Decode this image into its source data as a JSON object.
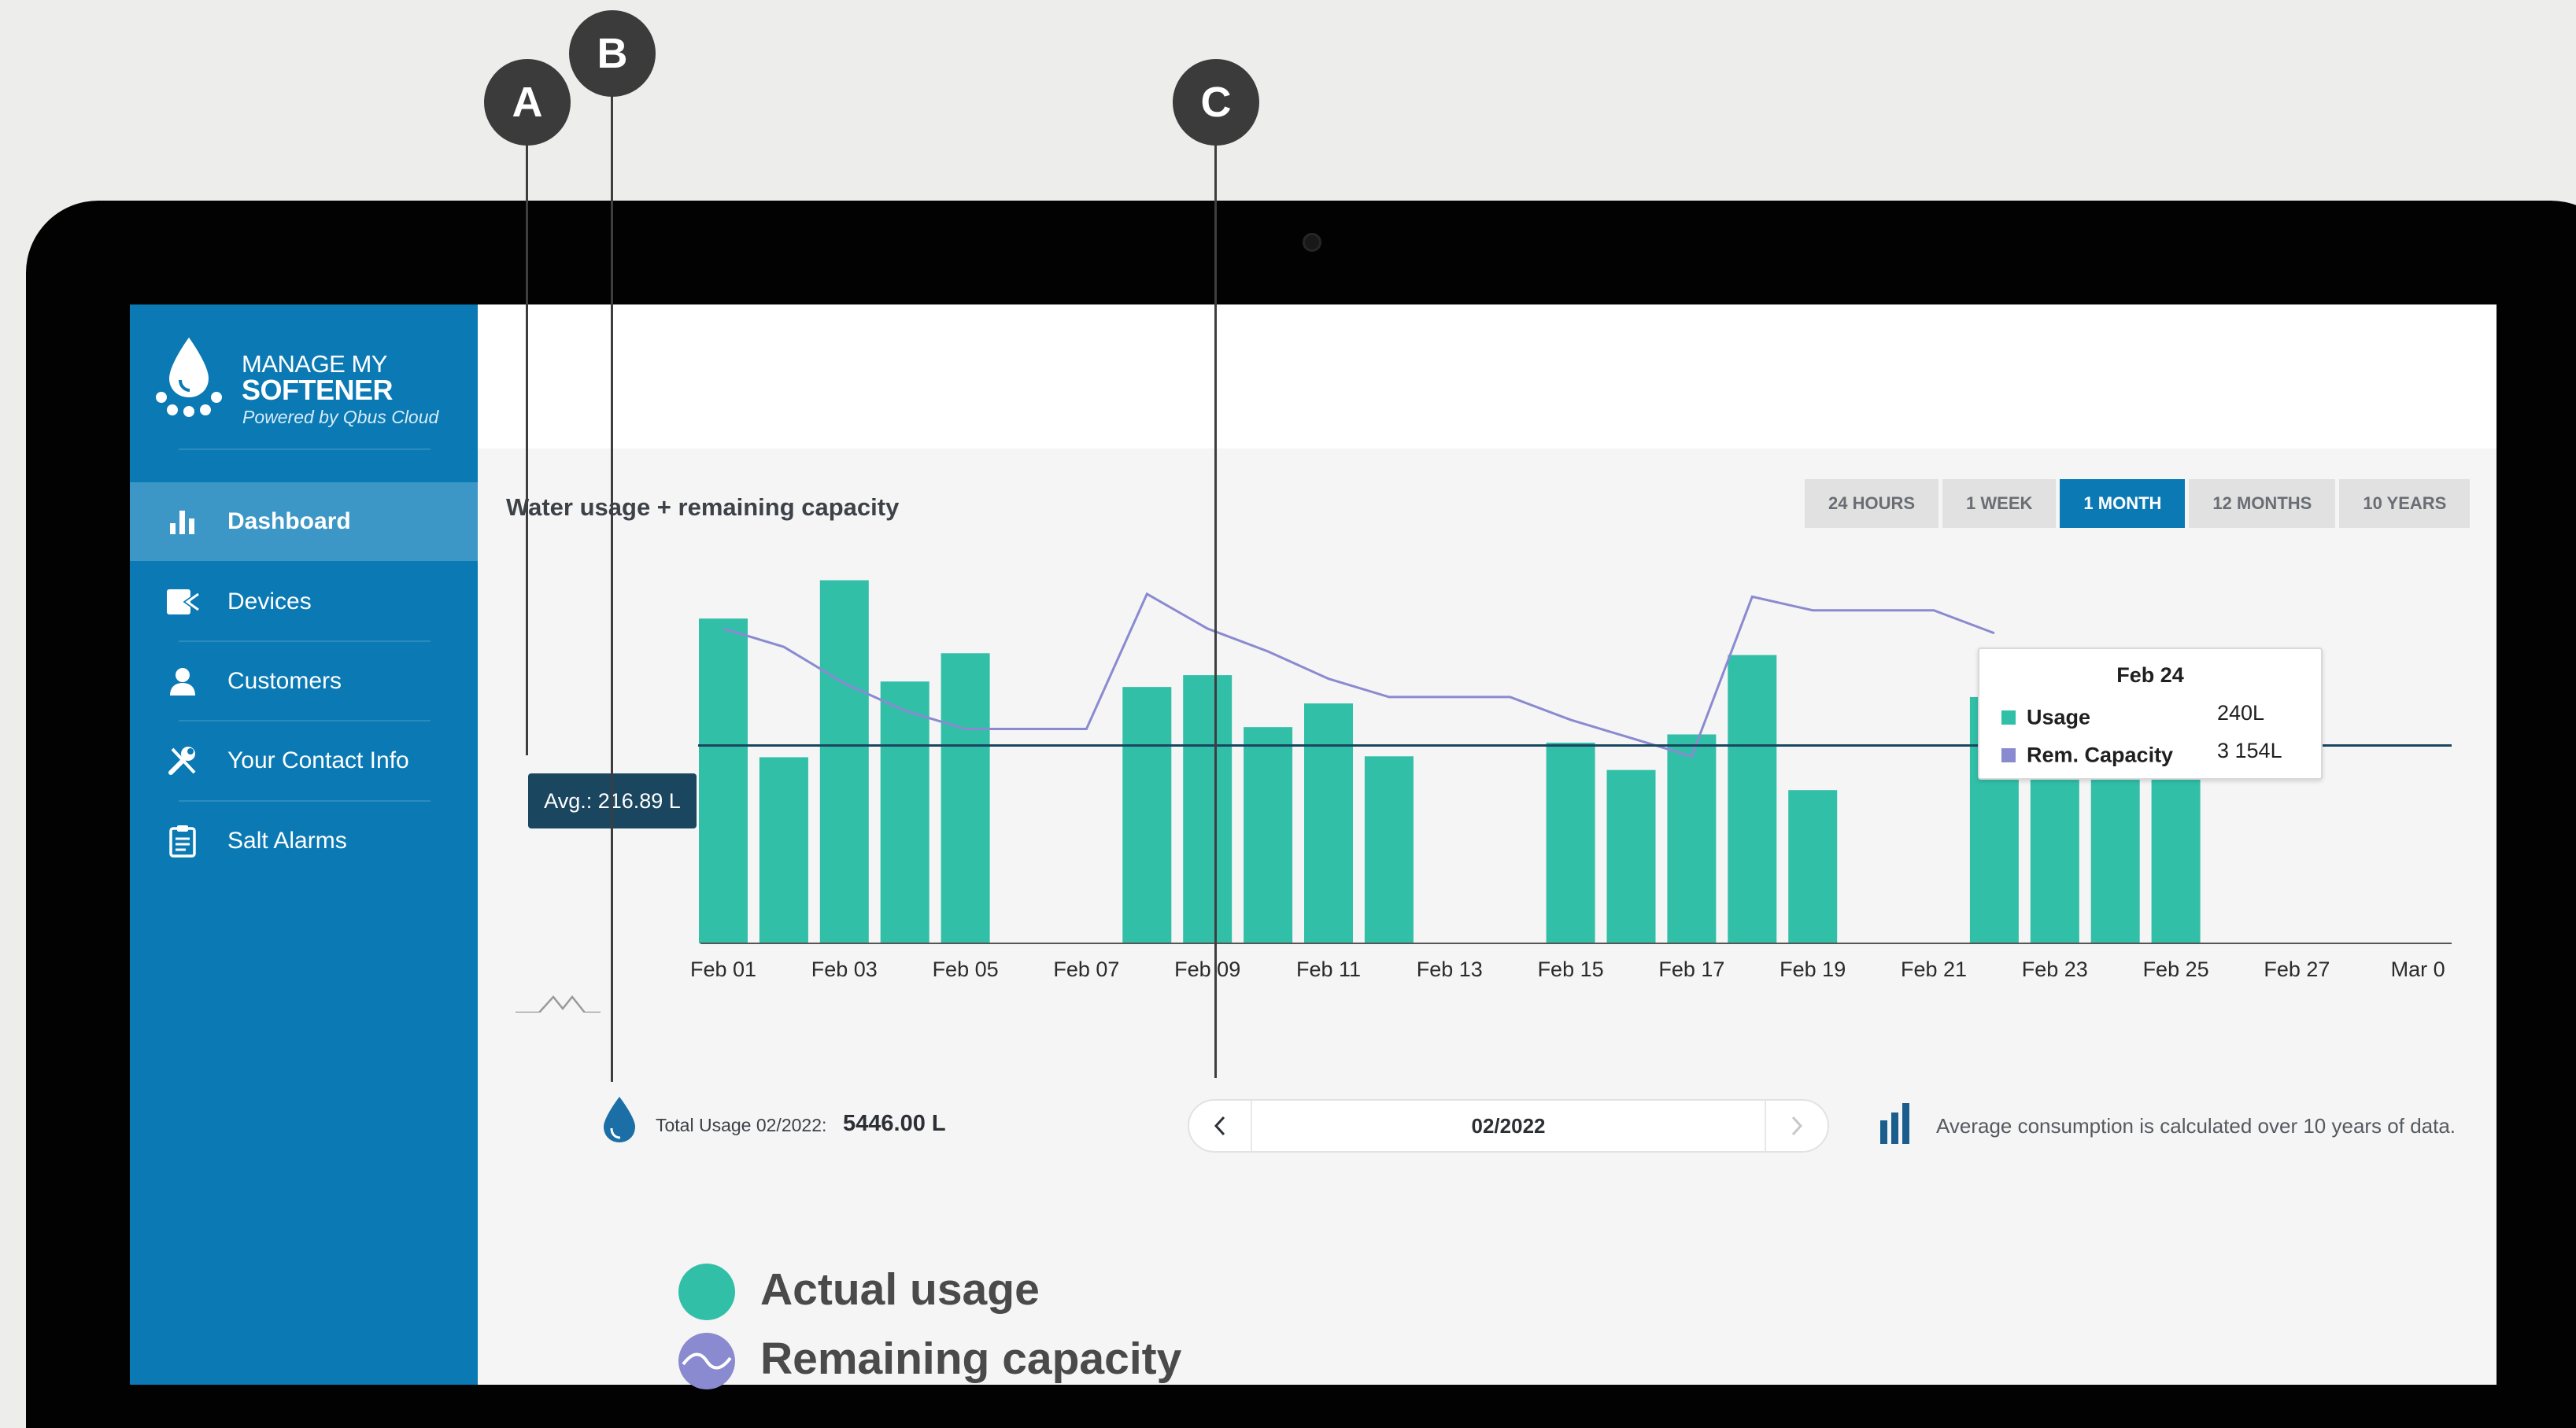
{
  "app": {
    "brand_line1": "MANAGE MY",
    "brand_line2": "SOFTENER",
    "brand_tagline": "Powered by Qbus Cloud"
  },
  "sidebar": {
    "items": [
      {
        "label": "Dashboard",
        "icon": "bar-chart-icon",
        "active": true
      },
      {
        "label": "Devices",
        "icon": "device-icon",
        "active": false
      },
      {
        "label": "Customers",
        "icon": "user-icon",
        "active": false
      },
      {
        "label": "Your Contact Info",
        "icon": "tools-icon",
        "active": false
      },
      {
        "label": "Salt Alarms",
        "icon": "clipboard-icon",
        "active": false
      }
    ]
  },
  "chart_panel": {
    "title": "Water usage + remaining capacity",
    "range_tabs": [
      "24 HOURS",
      "1 WEEK",
      "1 MONTH",
      "12 MONTHS",
      "10 YEARS"
    ],
    "selected_range": "1 MONTH",
    "avg_label": "Avg.: 216.89 L",
    "tooltip": {
      "date": "Feb 24",
      "usage_label": "Usage",
      "usage_value": "240L",
      "capacity_label": "Rem. Capacity",
      "capacity_value": "3 154L"
    }
  },
  "chart_data": {
    "type": "bar",
    "x_tick_labels": [
      "Feb 01",
      "Feb 03",
      "Feb 05",
      "Feb 07",
      "Feb 09",
      "Feb 11",
      "Feb 13",
      "Feb 15",
      "Feb 17",
      "Feb 19",
      "Feb 21",
      "Feb 23",
      "Feb 25",
      "Feb 27",
      "Mar 0"
    ],
    "categories": [
      "Feb 01",
      "Feb 02",
      "Feb 03",
      "Feb 04",
      "Feb 05",
      "Feb 06",
      "Feb 07",
      "Feb 08",
      "Feb 09",
      "Feb 10",
      "Feb 11",
      "Feb 12",
      "Feb 13",
      "Feb 14",
      "Feb 15",
      "Feb 16",
      "Feb 17",
      "Feb 18",
      "Feb 19",
      "Feb 20",
      "Feb 21",
      "Feb 22",
      "Feb 23",
      "Feb 24",
      "Feb 25",
      "Feb 26",
      "Feb 27",
      "Feb 28"
    ],
    "series": [
      {
        "kind": "bar",
        "color": "#31bfa8",
        "values": [
          356,
          204,
          398,
          287,
          318,
          0,
          0,
          281,
          294,
          237,
          263,
          205,
          0,
          0,
          220,
          190,
          229,
          316,
          168,
          0,
          0,
          270,
          261,
          243,
          240,
          0,
          0,
          0
        ]
      },
      {
        "kind": "line",
        "color": "#8a8ad0",
        "x": [
          "Feb 01",
          "Feb 02",
          "Feb 03",
          "Feb 04",
          "Feb 05",
          "Feb 06",
          "Feb 07",
          "Feb 08",
          "Feb 09",
          "Feb 10",
          "Feb 11",
          "Feb 12",
          "Feb 13",
          "Feb 14",
          "Feb 15",
          "Feb 16",
          "Feb 17",
          "Feb 18",
          "Feb 19",
          "Feb 20",
          "Feb 21",
          "Feb 22"
        ],
        "values": [
          345,
          325,
          285,
          255,
          235,
          235,
          235,
          383,
          345,
          320,
          290,
          270,
          270,
          270,
          245,
          225,
          205,
          380,
          365,
          365,
          365,
          340
        ]
      }
    ],
    "average": 216.89,
    "avg_line_color": "#1a4660",
    "ylim": [
      0,
      420
    ]
  },
  "footer": {
    "total_label": "Total Usage 02/2022:",
    "total_value": "5446.00 L",
    "month": "02/2022",
    "avg_note": "Average consumption is calculated over 10 years of data."
  },
  "legend": {
    "actual_usage": "Actual usage",
    "remaining_capacity": "Remaining capacity",
    "usage_color": "#31bfa8",
    "capacity_color": "#8a8ad0"
  },
  "callouts": [
    {
      "letter": "A"
    },
    {
      "letter": "B"
    },
    {
      "letter": "C"
    }
  ],
  "colors": {
    "sidebar": "#0a79b4",
    "sidebar_active": "#3c97c7",
    "accent": "#0a79b4"
  }
}
